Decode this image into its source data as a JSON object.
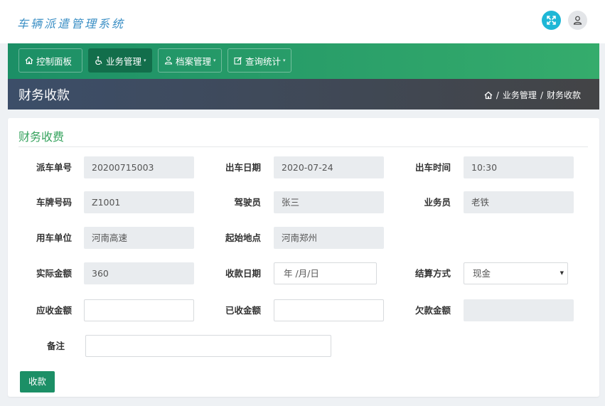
{
  "header": {
    "logo_text": "车辆派遣管理系统",
    "expand_icon": "expand-icon",
    "user_icon": "user-icon"
  },
  "nav": {
    "items": [
      {
        "label": "控制面板",
        "icon": "home-icon",
        "active": false
      },
      {
        "label": "业务管理",
        "icon": "accessible-icon",
        "active": true
      },
      {
        "label": "档案管理",
        "icon": "user-icon",
        "active": false
      },
      {
        "label": "查询统计",
        "icon": "edit-icon",
        "active": false
      }
    ]
  },
  "page_header": {
    "title": "财务收款",
    "breadcrumb": [
      "业务管理",
      "财务收款"
    ]
  },
  "form": {
    "title": "财务收费",
    "dispatch_no": {
      "label": "派车单号",
      "value": "20200715003"
    },
    "depart_date": {
      "label": "出车日期",
      "value": "2020-07-24"
    },
    "depart_time": {
      "label": "出车时间",
      "value": "10:30"
    },
    "plate_no": {
      "label": "车牌号码",
      "value": "Z1001"
    },
    "driver": {
      "label": "驾驶员",
      "value": "张三"
    },
    "salesman": {
      "label": "业务员",
      "value": "老铁"
    },
    "customer": {
      "label": "用车单位",
      "value": "河南高速"
    },
    "start_place": {
      "label": "起始地点",
      "value": "河南郑州"
    },
    "actual_amount": {
      "label": "实际金额",
      "value": "360"
    },
    "receipt_date": {
      "label": "收款日期",
      "value": "年 /月/日"
    },
    "settlement": {
      "label": "结算方式",
      "value": "现金"
    },
    "receivable": {
      "label": "应收金额",
      "value": ""
    },
    "received": {
      "label": "已收金额",
      "value": ""
    },
    "arrears": {
      "label": "欠款金额",
      "value": ""
    },
    "remark": {
      "label": "备注",
      "value": ""
    },
    "submit_label": "收款"
  },
  "colors": {
    "nav_start": "#1c8f66",
    "nav_end": "#35ac6c",
    "accent_green": "#36a35e",
    "expand_cyan": "#1eb7d6"
  }
}
